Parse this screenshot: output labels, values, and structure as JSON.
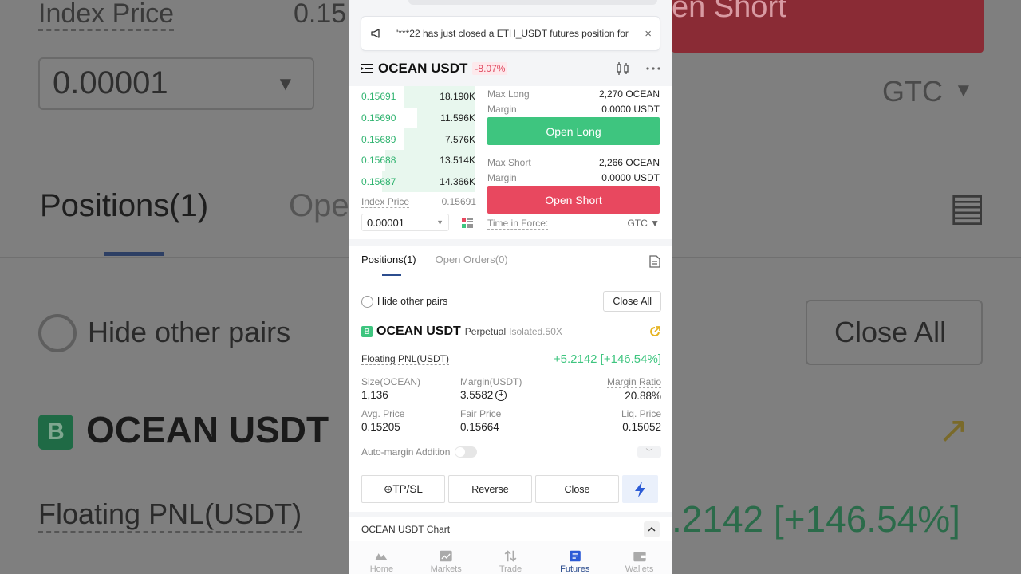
{
  "background": {
    "index_price_label": "Index Price",
    "index_price_value": "0.15",
    "precision_value": "0.00001",
    "tif_value": "GTC",
    "positions_tab": "Positions(1)",
    "orders_tab_partial": "Ope",
    "hide_pairs": "Hide other pairs",
    "close_all": "Close All",
    "badge": "B",
    "pair": "OCEAN USDT",
    "floating_pnl": "Floating PNL(USDT)",
    "pnl_value": ".2142 [+146.54%]",
    "short_partial": "en Short"
  },
  "ticker": {
    "text": "'***22 has just closed a ETH_USDT futures position for",
    "close_glyph": "×"
  },
  "header": {
    "pair": "OCEAN USDT",
    "change": "-8.07%"
  },
  "orderbook": {
    "rows": [
      {
        "price": "0.15691",
        "qty": "18.190K",
        "depth": 0.55
      },
      {
        "price": "0.15690",
        "qty": "11.596K",
        "depth": 0.45
      },
      {
        "price": "0.15689",
        "qty": "7.576K",
        "depth": 0.55
      },
      {
        "price": "0.15688",
        "qty": "13.514K",
        "depth": 0.7
      },
      {
        "price": "0.15687",
        "qty": "14.366K",
        "depth": 0.72
      }
    ],
    "index_label": "Index Price",
    "index_value": "0.15691",
    "precision": "0.00001",
    "precision_caret": "▼"
  },
  "order_panel": {
    "max_long_label": "Max Long",
    "max_long_value": "2,270 OCEAN",
    "margin_label": "Margin",
    "long_margin_value": "0.0000 USDT",
    "open_long": "Open Long",
    "max_short_label": "Max Short",
    "max_short_value": "2,266 OCEAN",
    "short_margin_value": "0.0000 USDT",
    "open_short": "Open Short",
    "tif_label": "Time in Force:",
    "tif_value": "GTC ▼"
  },
  "tabs": {
    "positions": "Positions(1)",
    "orders": "Open Orders(0)"
  },
  "filter": {
    "hide_pairs": "Hide other pairs",
    "close_all": "Close All"
  },
  "position": {
    "badge": "B",
    "pair": "OCEAN USDT",
    "type": "Perpetual",
    "mode": "Isolated.50X",
    "pnl_label": "Floating PNL(USDT)",
    "pnl_value": "+5.2142 [+146.54%]",
    "size_label": "Size(OCEAN)",
    "size_value": "1,136",
    "margin_label": "Margin(USDT)",
    "margin_value": "3.5582",
    "margin_ratio_label": "Margin Ratio",
    "margin_ratio_value": "20.88%",
    "avg_label": "Avg. Price",
    "avg_value": "0.15205",
    "fair_label": "Fair Price",
    "fair_value": "0.15664",
    "liq_label": "Liq. Price",
    "liq_value": "0.15052",
    "auto_margin": "Auto-margin Addition",
    "tpsl": "⊕TP/SL",
    "reverse": "Reverse",
    "close": "Close"
  },
  "chart_section": {
    "label": "OCEAN USDT Chart"
  },
  "nav": {
    "items": [
      "Home",
      "Markets",
      "Trade",
      "Futures",
      "Wallets"
    ],
    "active": "Futures"
  },
  "colors": {
    "green": "#3ec57f",
    "red": "#e8485f",
    "accent": "#2c4d8e"
  }
}
